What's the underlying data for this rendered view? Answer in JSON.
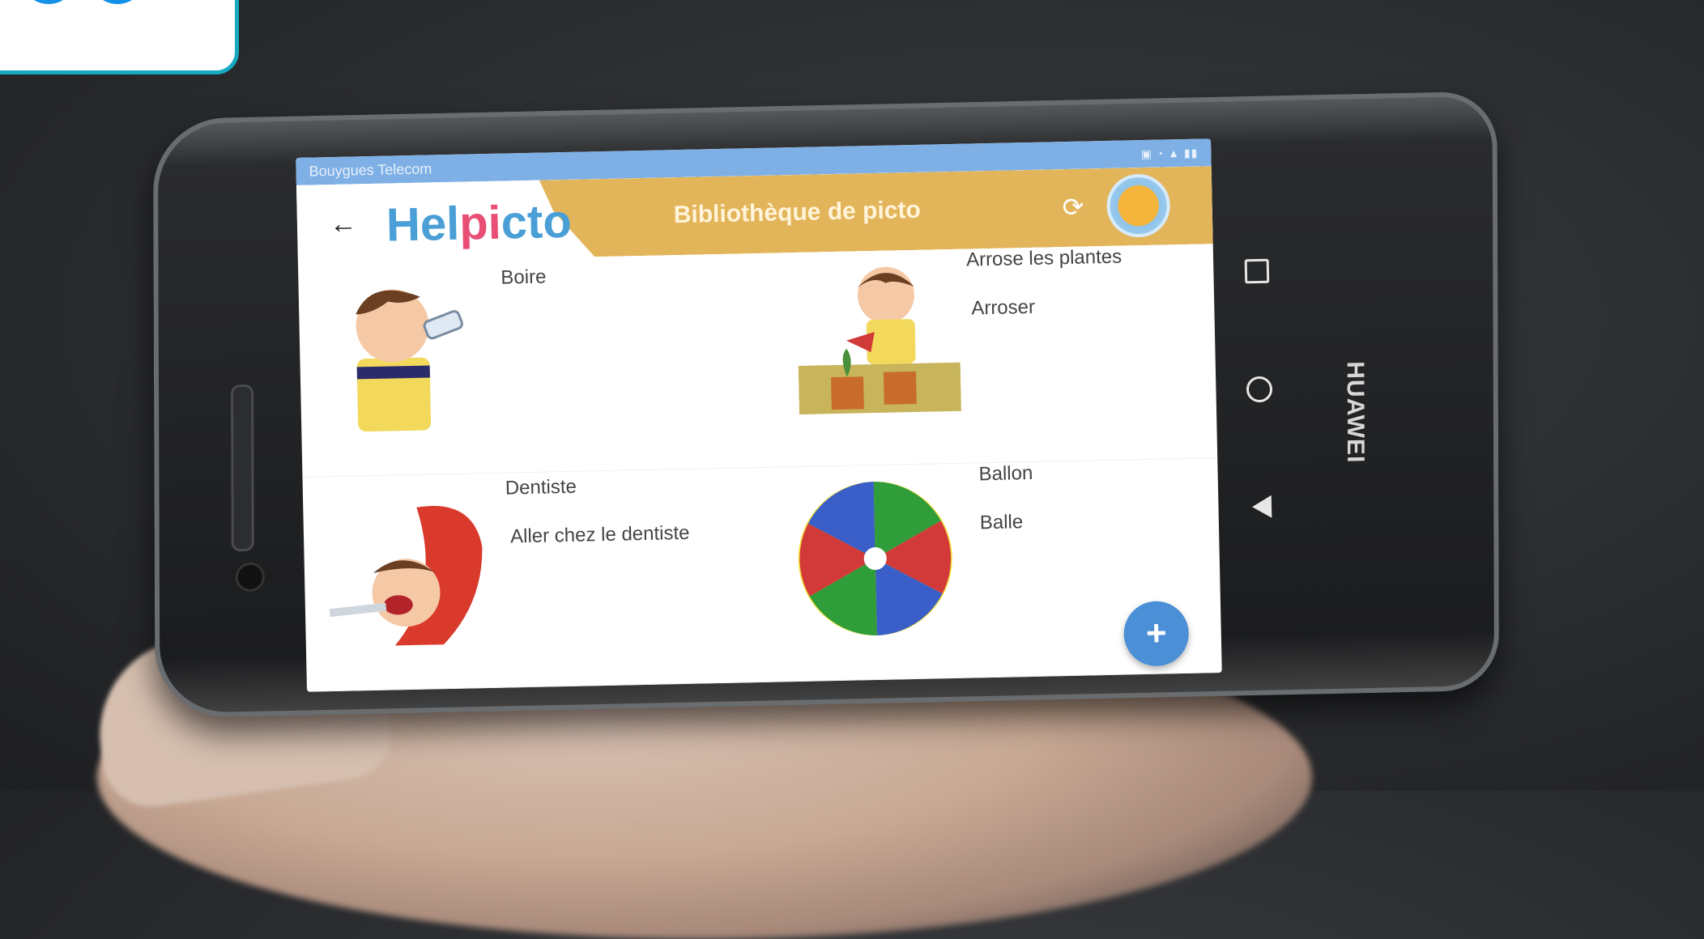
{
  "status_bar": {
    "carrier": "Bouygues Telecom"
  },
  "app_bar": {
    "logo_text_a": "Hel",
    "logo_text_b": "pi",
    "logo_text_c": "cto",
    "title": "Bibliothèque de picto"
  },
  "pictos": [
    {
      "labels": [
        "Boire"
      ],
      "icon": "child-drinking-picto"
    },
    {
      "labels": [
        "Arrose les plantes",
        "Arroser"
      ],
      "icon": "child-watering-plants-picto"
    },
    {
      "labels": [
        "Dentiste",
        "Aller chez le dentiste"
      ],
      "icon": "dentist-picto"
    },
    {
      "labels": [
        "Ballon",
        "Balle"
      ],
      "icon": "beach-ball-picto"
    }
  ],
  "fab": {
    "label": "+"
  },
  "device": {
    "brand": "HUAWEI"
  },
  "colors": {
    "status_bar": "#7eb0e6",
    "app_bar_gold": "#e3b55a",
    "logo_blue": "#4a9fd6",
    "logo_pink": "#e94e75",
    "fab_blue": "#4b8fd7"
  }
}
